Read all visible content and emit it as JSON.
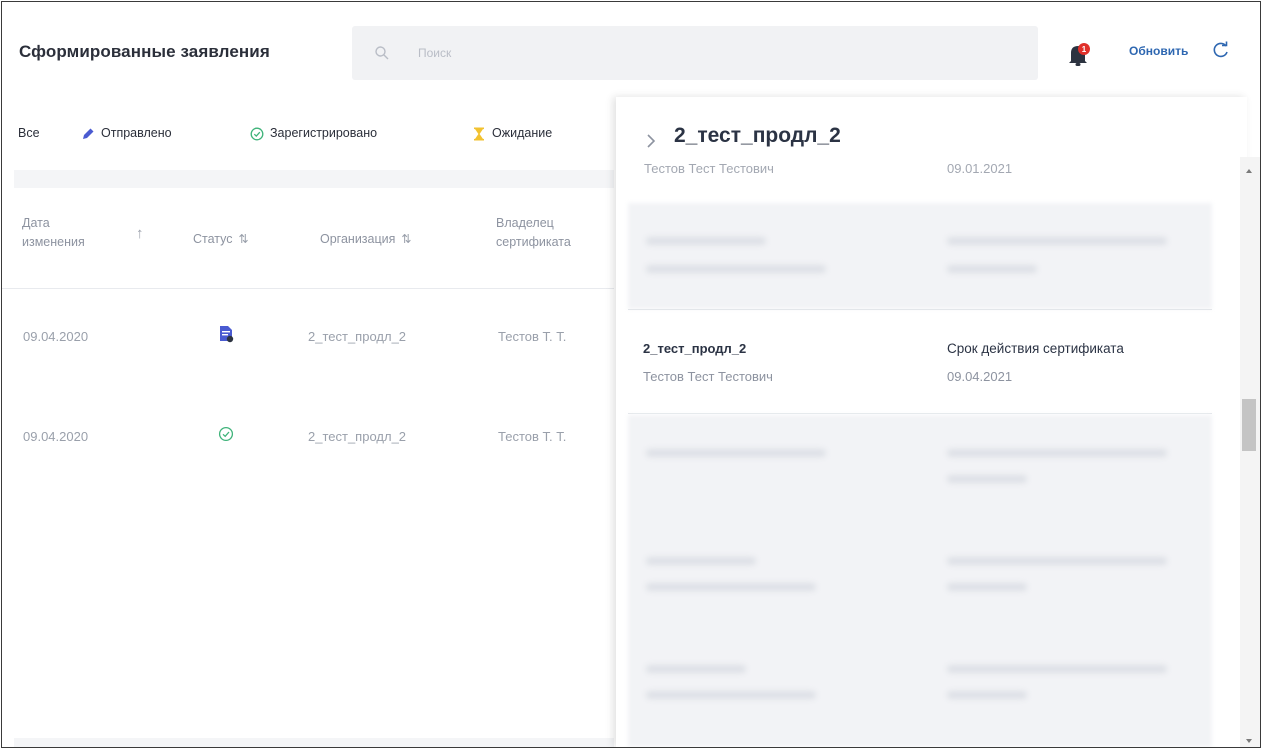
{
  "header": {
    "title": "Сформированные заявления",
    "search_placeholder": "Поиск",
    "notifications_badge": "1",
    "refresh_label": "Обновить"
  },
  "filters": [
    {
      "label": "Все",
      "icon": "none"
    },
    {
      "label": "Отправлено",
      "icon": "pen-icon"
    },
    {
      "label": "Зарегистрировано",
      "icon": "check-circle-icon"
    },
    {
      "label": "Ожидание",
      "icon": "hourglass-icon"
    }
  ],
  "table": {
    "columns": [
      {
        "label": "Дата изменения",
        "sort": "↑"
      },
      {
        "label": "Статус",
        "sort": "⇅"
      },
      {
        "label": "Организация",
        "sort": "⇅"
      },
      {
        "label": "Владелец сертификата",
        "sort": ""
      }
    ],
    "rows": [
      {
        "date": "09.04.2020",
        "status_icon": "document-status-icon",
        "org": "2_тест_продл_2",
        "owner": "Тестов Т. Т."
      },
      {
        "date": "09.04.2020",
        "status_icon": "check-circle-icon",
        "org": "2_тест_продл_2",
        "owner": "Тестов Т. Т."
      }
    ]
  },
  "panel": {
    "title": "2_тест_продл_2",
    "header_name": "Тестов Тест Тестович",
    "header_date": "09.01.2021",
    "card": {
      "title": "2_тест_продл_2",
      "subtitle": "Тестов Тест Тестович",
      "right_title": "Срок действия сертификата",
      "right_value": "09.04.2021"
    }
  },
  "colors": {
    "accent": "#2e67b1",
    "success": "#3fb37a",
    "warning": "#f2c230",
    "badge": "#e0302a",
    "status_doc": "#4a5bd1"
  }
}
